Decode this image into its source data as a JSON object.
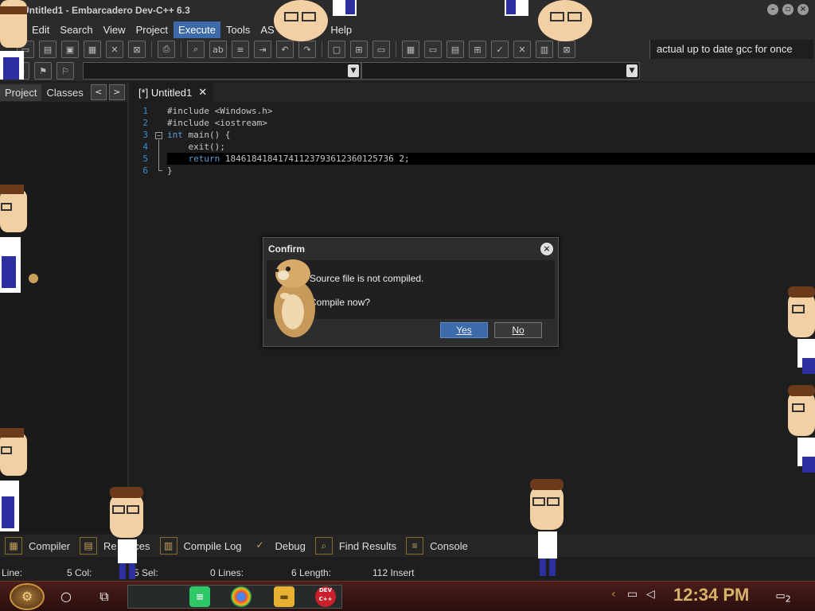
{
  "window": {
    "title": "Untitled1 - Embarcadero Dev-C++ 6.3",
    "controls": [
      "minimize-icon",
      "restore-icon",
      "close-icon"
    ]
  },
  "menu": {
    "items": [
      {
        "label": "Edit",
        "active": false
      },
      {
        "label": "Search",
        "active": false
      },
      {
        "label": "View",
        "active": false
      },
      {
        "label": "Project",
        "active": false
      },
      {
        "label": "Execute",
        "active": true
      },
      {
        "label": "Tools",
        "active": false
      },
      {
        "label": "AS",
        "active": false
      },
      {
        "label": "ow",
        "active": false
      },
      {
        "label": "Help",
        "active": false
      }
    ]
  },
  "toolbar": {
    "compiler_label": "actual up to date gcc for once"
  },
  "left_panel": {
    "tabs": [
      "Project",
      "Classes"
    ],
    "nav_prev": "<",
    "nav_next": ">"
  },
  "editor": {
    "tab_label": "[*] Untitled1",
    "tab_close": "✕",
    "line_numbers": [
      "1",
      "2",
      "3",
      "4",
      "5",
      "6"
    ],
    "lines": [
      "#include <Windows.h>",
      "#include <iostream>",
      "int main() {",
      "    exit();",
      "    return 18461841841741123793612360125736 2;",
      "}"
    ],
    "line1": "#include <Windows.h>",
    "line2": "#include <iostream>",
    "line3_kw": "int",
    "line3_rest": " main() {",
    "line4": "    exit();",
    "line5_kw": "return",
    "line5_rest": " 18461841841741123793612360125736 2;",
    "line6": "}"
  },
  "bottom_tabs": [
    "Compiler",
    "Resources",
    "Compile Log",
    "Debug",
    "Find Results",
    "Console"
  ],
  "bottom_tabs_visible": {
    "compiler": "Compiler",
    "resources": "Re      ces",
    "compile_log": "Compile Log",
    "debug": "Debug",
    "find_results": "Find Results",
    "console": "Console"
  },
  "status": {
    "line_label": "Line:",
    "line_value": "5 Col:",
    "col_value": "5 Sel:",
    "sel_value": "0 Lines:",
    "lines_value": "6 Length:",
    "length_value": "112 Insert"
  },
  "dialog": {
    "title": "Confirm",
    "message1": "Source file is not compiled.",
    "message2": "Compile now?",
    "yes_label": "Yes",
    "no_label": "No"
  },
  "taskbar": {
    "clock": "12:34 PM",
    "notification_count": "2",
    "devcpp_label": "DEV C++"
  },
  "colors": {
    "accent": "#3d6aa8",
    "line_number": "#3b8fd1",
    "keyword": "#5a9bd5",
    "clock": "#d8b36a"
  }
}
